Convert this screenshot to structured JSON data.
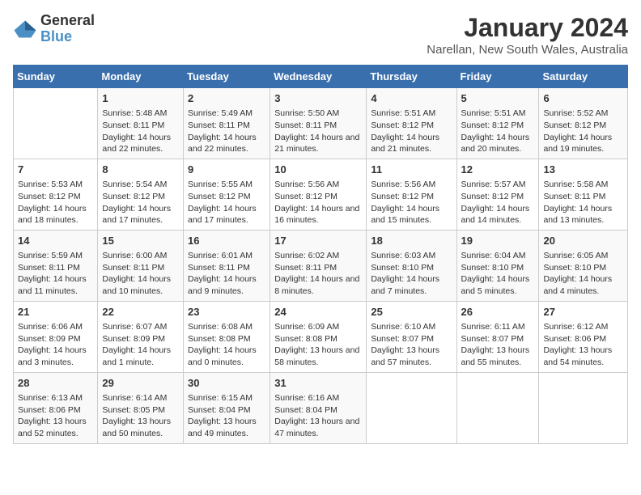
{
  "logo": {
    "line1": "General",
    "line2": "Blue"
  },
  "title": "January 2024",
  "subtitle": "Narellan, New South Wales, Australia",
  "days_of_week": [
    "Sunday",
    "Monday",
    "Tuesday",
    "Wednesday",
    "Thursday",
    "Friday",
    "Saturday"
  ],
  "weeks": [
    [
      {
        "day": "",
        "sunrise": "",
        "sunset": "",
        "daylight": ""
      },
      {
        "day": "1",
        "sunrise": "5:48 AM",
        "sunset": "8:11 PM",
        "daylight": "14 hours and 22 minutes."
      },
      {
        "day": "2",
        "sunrise": "5:49 AM",
        "sunset": "8:11 PM",
        "daylight": "14 hours and 22 minutes."
      },
      {
        "day": "3",
        "sunrise": "5:50 AM",
        "sunset": "8:11 PM",
        "daylight": "14 hours and 21 minutes."
      },
      {
        "day": "4",
        "sunrise": "5:51 AM",
        "sunset": "8:12 PM",
        "daylight": "14 hours and 21 minutes."
      },
      {
        "day": "5",
        "sunrise": "5:51 AM",
        "sunset": "8:12 PM",
        "daylight": "14 hours and 20 minutes."
      },
      {
        "day": "6",
        "sunrise": "5:52 AM",
        "sunset": "8:12 PM",
        "daylight": "14 hours and 19 minutes."
      }
    ],
    [
      {
        "day": "7",
        "sunrise": "5:53 AM",
        "sunset": "8:12 PM",
        "daylight": "14 hours and 18 minutes."
      },
      {
        "day": "8",
        "sunrise": "5:54 AM",
        "sunset": "8:12 PM",
        "daylight": "14 hours and 17 minutes."
      },
      {
        "day": "9",
        "sunrise": "5:55 AM",
        "sunset": "8:12 PM",
        "daylight": "14 hours and 17 minutes."
      },
      {
        "day": "10",
        "sunrise": "5:56 AM",
        "sunset": "8:12 PM",
        "daylight": "14 hours and 16 minutes."
      },
      {
        "day": "11",
        "sunrise": "5:56 AM",
        "sunset": "8:12 PM",
        "daylight": "14 hours and 15 minutes."
      },
      {
        "day": "12",
        "sunrise": "5:57 AM",
        "sunset": "8:12 PM",
        "daylight": "14 hours and 14 minutes."
      },
      {
        "day": "13",
        "sunrise": "5:58 AM",
        "sunset": "8:11 PM",
        "daylight": "14 hours and 13 minutes."
      }
    ],
    [
      {
        "day": "14",
        "sunrise": "5:59 AM",
        "sunset": "8:11 PM",
        "daylight": "14 hours and 11 minutes."
      },
      {
        "day": "15",
        "sunrise": "6:00 AM",
        "sunset": "8:11 PM",
        "daylight": "14 hours and 10 minutes."
      },
      {
        "day": "16",
        "sunrise": "6:01 AM",
        "sunset": "8:11 PM",
        "daylight": "14 hours and 9 minutes."
      },
      {
        "day": "17",
        "sunrise": "6:02 AM",
        "sunset": "8:11 PM",
        "daylight": "14 hours and 8 minutes."
      },
      {
        "day": "18",
        "sunrise": "6:03 AM",
        "sunset": "8:10 PM",
        "daylight": "14 hours and 7 minutes."
      },
      {
        "day": "19",
        "sunrise": "6:04 AM",
        "sunset": "8:10 PM",
        "daylight": "14 hours and 5 minutes."
      },
      {
        "day": "20",
        "sunrise": "6:05 AM",
        "sunset": "8:10 PM",
        "daylight": "14 hours and 4 minutes."
      }
    ],
    [
      {
        "day": "21",
        "sunrise": "6:06 AM",
        "sunset": "8:09 PM",
        "daylight": "14 hours and 3 minutes."
      },
      {
        "day": "22",
        "sunrise": "6:07 AM",
        "sunset": "8:09 PM",
        "daylight": "14 hours and 1 minute."
      },
      {
        "day": "23",
        "sunrise": "6:08 AM",
        "sunset": "8:08 PM",
        "daylight": "14 hours and 0 minutes."
      },
      {
        "day": "24",
        "sunrise": "6:09 AM",
        "sunset": "8:08 PM",
        "daylight": "13 hours and 58 minutes."
      },
      {
        "day": "25",
        "sunrise": "6:10 AM",
        "sunset": "8:07 PM",
        "daylight": "13 hours and 57 minutes."
      },
      {
        "day": "26",
        "sunrise": "6:11 AM",
        "sunset": "8:07 PM",
        "daylight": "13 hours and 55 minutes."
      },
      {
        "day": "27",
        "sunrise": "6:12 AM",
        "sunset": "8:06 PM",
        "daylight": "13 hours and 54 minutes."
      }
    ],
    [
      {
        "day": "28",
        "sunrise": "6:13 AM",
        "sunset": "8:06 PM",
        "daylight": "13 hours and 52 minutes."
      },
      {
        "day": "29",
        "sunrise": "6:14 AM",
        "sunset": "8:05 PM",
        "daylight": "13 hours and 50 minutes."
      },
      {
        "day": "30",
        "sunrise": "6:15 AM",
        "sunset": "8:04 PM",
        "daylight": "13 hours and 49 minutes."
      },
      {
        "day": "31",
        "sunrise": "6:16 AM",
        "sunset": "8:04 PM",
        "daylight": "13 hours and 47 minutes."
      },
      {
        "day": "",
        "sunrise": "",
        "sunset": "",
        "daylight": ""
      },
      {
        "day": "",
        "sunrise": "",
        "sunset": "",
        "daylight": ""
      },
      {
        "day": "",
        "sunrise": "",
        "sunset": "",
        "daylight": ""
      }
    ]
  ]
}
